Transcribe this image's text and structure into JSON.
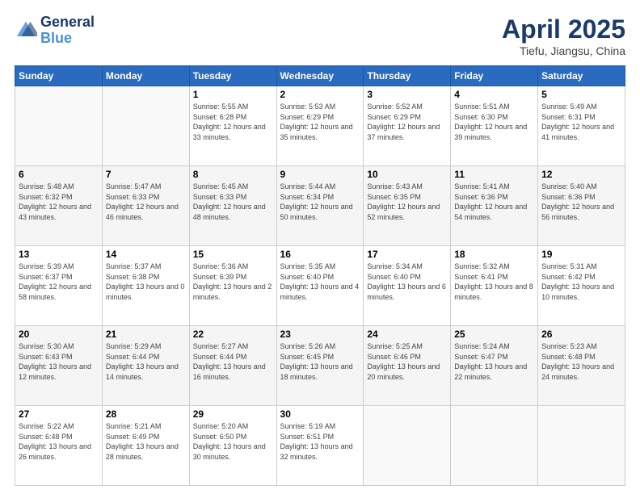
{
  "header": {
    "logo_line1": "General",
    "logo_line2": "Blue",
    "title": "April 2025",
    "subtitle": "Tiefu, Jiangsu, China"
  },
  "calendar": {
    "days_of_week": [
      "Sunday",
      "Monday",
      "Tuesday",
      "Wednesday",
      "Thursday",
      "Friday",
      "Saturday"
    ],
    "weeks": [
      [
        {
          "day": "",
          "info": ""
        },
        {
          "day": "",
          "info": ""
        },
        {
          "day": "1",
          "info": "Sunrise: 5:55 AM\nSunset: 6:28 PM\nDaylight: 12 hours and 33 minutes."
        },
        {
          "day": "2",
          "info": "Sunrise: 5:53 AM\nSunset: 6:29 PM\nDaylight: 12 hours and 35 minutes."
        },
        {
          "day": "3",
          "info": "Sunrise: 5:52 AM\nSunset: 6:29 PM\nDaylight: 12 hours and 37 minutes."
        },
        {
          "day": "4",
          "info": "Sunrise: 5:51 AM\nSunset: 6:30 PM\nDaylight: 12 hours and 39 minutes."
        },
        {
          "day": "5",
          "info": "Sunrise: 5:49 AM\nSunset: 6:31 PM\nDaylight: 12 hours and 41 minutes."
        }
      ],
      [
        {
          "day": "6",
          "info": "Sunrise: 5:48 AM\nSunset: 6:32 PM\nDaylight: 12 hours and 43 minutes."
        },
        {
          "day": "7",
          "info": "Sunrise: 5:47 AM\nSunset: 6:33 PM\nDaylight: 12 hours and 46 minutes."
        },
        {
          "day": "8",
          "info": "Sunrise: 5:45 AM\nSunset: 6:33 PM\nDaylight: 12 hours and 48 minutes."
        },
        {
          "day": "9",
          "info": "Sunrise: 5:44 AM\nSunset: 6:34 PM\nDaylight: 12 hours and 50 minutes."
        },
        {
          "day": "10",
          "info": "Sunrise: 5:43 AM\nSunset: 6:35 PM\nDaylight: 12 hours and 52 minutes."
        },
        {
          "day": "11",
          "info": "Sunrise: 5:41 AM\nSunset: 6:36 PM\nDaylight: 12 hours and 54 minutes."
        },
        {
          "day": "12",
          "info": "Sunrise: 5:40 AM\nSunset: 6:36 PM\nDaylight: 12 hours and 56 minutes."
        }
      ],
      [
        {
          "day": "13",
          "info": "Sunrise: 5:39 AM\nSunset: 6:37 PM\nDaylight: 12 hours and 58 minutes."
        },
        {
          "day": "14",
          "info": "Sunrise: 5:37 AM\nSunset: 6:38 PM\nDaylight: 13 hours and 0 minutes."
        },
        {
          "day": "15",
          "info": "Sunrise: 5:36 AM\nSunset: 6:39 PM\nDaylight: 13 hours and 2 minutes."
        },
        {
          "day": "16",
          "info": "Sunrise: 5:35 AM\nSunset: 6:40 PM\nDaylight: 13 hours and 4 minutes."
        },
        {
          "day": "17",
          "info": "Sunrise: 5:34 AM\nSunset: 6:40 PM\nDaylight: 13 hours and 6 minutes."
        },
        {
          "day": "18",
          "info": "Sunrise: 5:32 AM\nSunset: 6:41 PM\nDaylight: 13 hours and 8 minutes."
        },
        {
          "day": "19",
          "info": "Sunrise: 5:31 AM\nSunset: 6:42 PM\nDaylight: 13 hours and 10 minutes."
        }
      ],
      [
        {
          "day": "20",
          "info": "Sunrise: 5:30 AM\nSunset: 6:43 PM\nDaylight: 13 hours and 12 minutes."
        },
        {
          "day": "21",
          "info": "Sunrise: 5:29 AM\nSunset: 6:44 PM\nDaylight: 13 hours and 14 minutes."
        },
        {
          "day": "22",
          "info": "Sunrise: 5:27 AM\nSunset: 6:44 PM\nDaylight: 13 hours and 16 minutes."
        },
        {
          "day": "23",
          "info": "Sunrise: 5:26 AM\nSunset: 6:45 PM\nDaylight: 13 hours and 18 minutes."
        },
        {
          "day": "24",
          "info": "Sunrise: 5:25 AM\nSunset: 6:46 PM\nDaylight: 13 hours and 20 minutes."
        },
        {
          "day": "25",
          "info": "Sunrise: 5:24 AM\nSunset: 6:47 PM\nDaylight: 13 hours and 22 minutes."
        },
        {
          "day": "26",
          "info": "Sunrise: 5:23 AM\nSunset: 6:48 PM\nDaylight: 13 hours and 24 minutes."
        }
      ],
      [
        {
          "day": "27",
          "info": "Sunrise: 5:22 AM\nSunset: 6:48 PM\nDaylight: 13 hours and 26 minutes."
        },
        {
          "day": "28",
          "info": "Sunrise: 5:21 AM\nSunset: 6:49 PM\nDaylight: 13 hours and 28 minutes."
        },
        {
          "day": "29",
          "info": "Sunrise: 5:20 AM\nSunset: 6:50 PM\nDaylight: 13 hours and 30 minutes."
        },
        {
          "day": "30",
          "info": "Sunrise: 5:19 AM\nSunset: 6:51 PM\nDaylight: 13 hours and 32 minutes."
        },
        {
          "day": "",
          "info": ""
        },
        {
          "day": "",
          "info": ""
        },
        {
          "day": "",
          "info": ""
        }
      ]
    ]
  }
}
